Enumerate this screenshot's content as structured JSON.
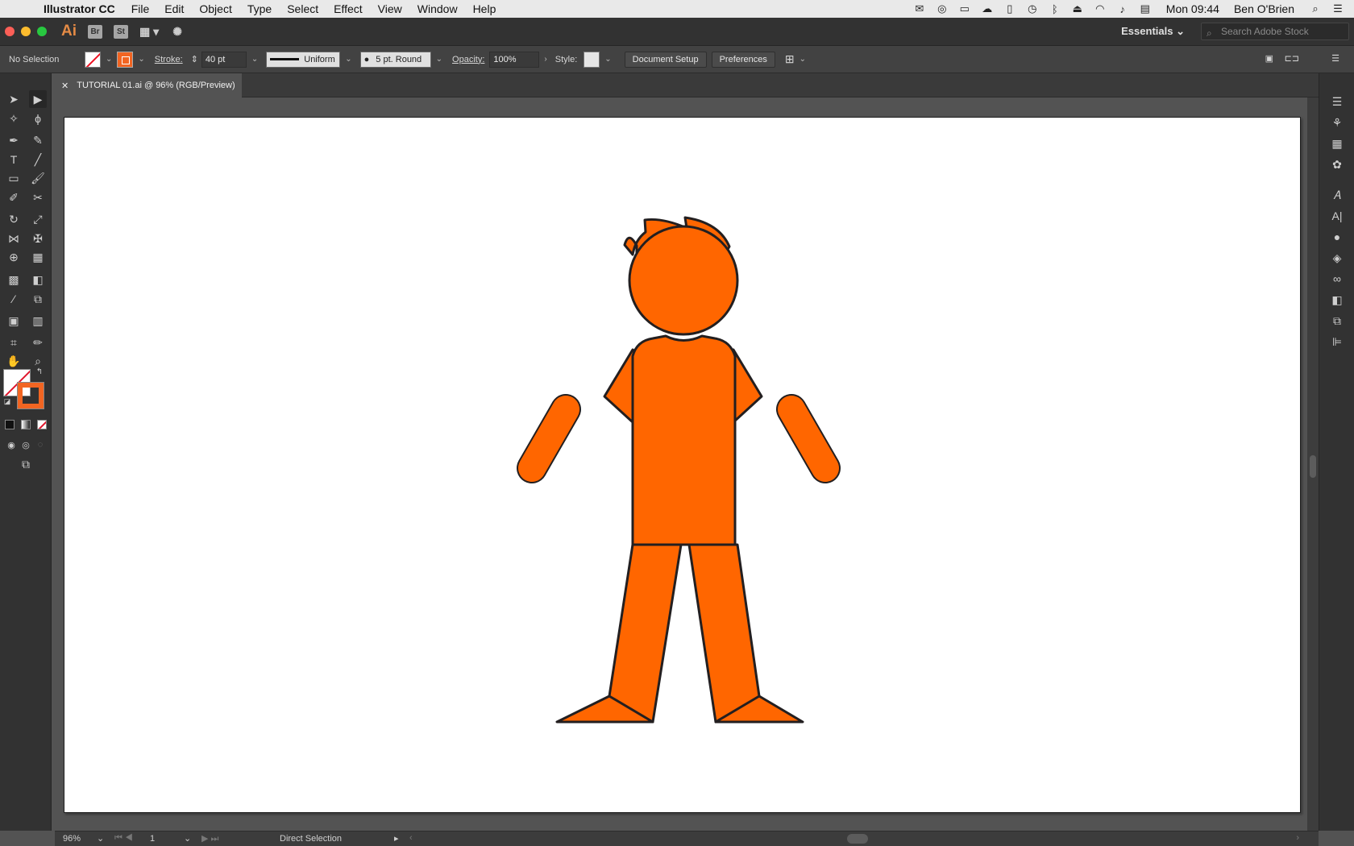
{
  "menubar": {
    "app_name": "Illustrator CC",
    "menus": [
      "File",
      "Edit",
      "Object",
      "Type",
      "Select",
      "Effect",
      "View",
      "Window",
      "Help"
    ],
    "clock": "Mon 09:44",
    "user": "Ben O'Brien"
  },
  "appbar": {
    "logo": "Ai",
    "bridge": "Br",
    "stock": "St",
    "workspace": "Essentials",
    "search_placeholder": "Search Adobe Stock"
  },
  "controlbar": {
    "selection": "No Selection",
    "stroke_label": "Stroke:",
    "stroke_weight": "40 pt",
    "profile": "Uniform",
    "brush": "5 pt. Round",
    "opacity_label": "Opacity:",
    "opacity": "100%",
    "style_label": "Style:",
    "document_setup": "Document Setup",
    "preferences": "Preferences"
  },
  "document": {
    "tab_title": "TUTORIAL 01.ai @ 96% (RGB/Preview)"
  },
  "statusbar": {
    "zoom": "96%",
    "page": "1",
    "tool": "Direct Selection"
  },
  "colors": {
    "accent": "#ff6600",
    "outline": "#231f20"
  }
}
